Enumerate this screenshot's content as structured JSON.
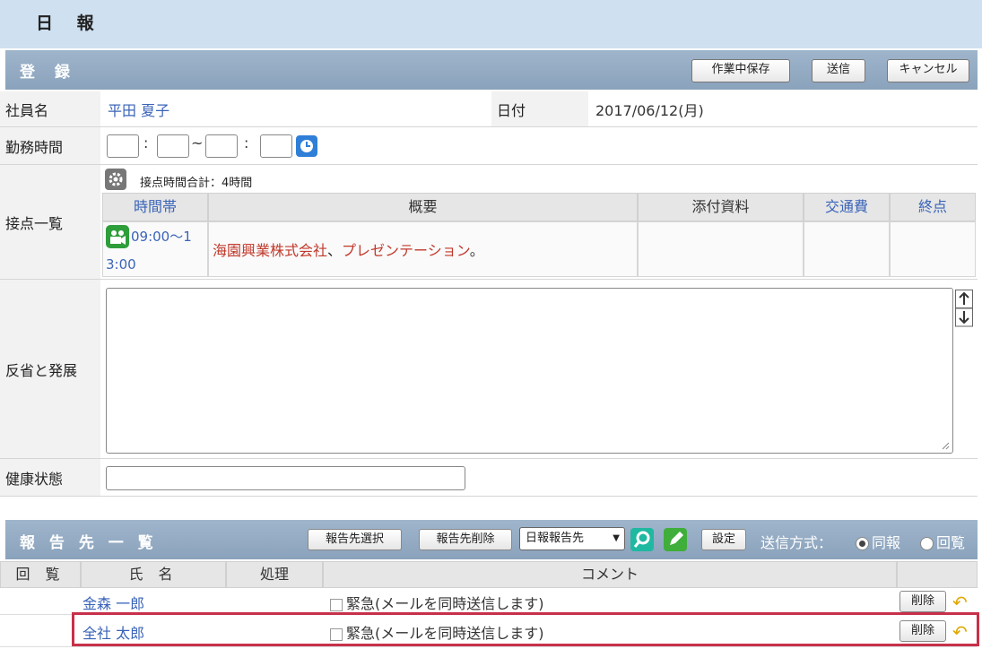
{
  "page": {
    "title": "日 報"
  },
  "register": {
    "section_title": "登 録",
    "buttons": {
      "save_progress": "作業中保存",
      "send": "送信",
      "cancel": "キャンセル"
    },
    "employee": {
      "label": "社員名",
      "value": "平田 夏子"
    },
    "date": {
      "label": "日付",
      "value": "2017/06/12(月)"
    },
    "work_time": {
      "label": "勤務時間",
      "sep1": ":",
      "range_sep": "~",
      "sep2": ":"
    },
    "contacts": {
      "label": "接点一覧",
      "total": "接点時間合計：4時間",
      "headers": {
        "time": "時間帯",
        "summary": "概要",
        "attachment": "添付資料",
        "transport": "交通費",
        "end": "終点"
      },
      "rows": [
        {
          "time_line1": "09:00〜1",
          "time_line2": "3:00",
          "company": "海園興業株式会社",
          "sep": "、",
          "activity": "プレゼンテーション",
          "end_mark": "。"
        }
      ]
    },
    "reflection": {
      "label": "反省と発展",
      "value": ""
    },
    "health": {
      "label": "健康状態",
      "value": ""
    }
  },
  "report_list": {
    "section_title": "報 告 先 一 覧",
    "select_button": "報告先選択",
    "delete_button": "報告先削除",
    "dropdown_value": "日報報告先",
    "settings_button": "設定",
    "send_method_label": "送信方式：",
    "radio_same": "同報",
    "radio_circulate": "回覧",
    "headers": {
      "circulate": "回 覧",
      "name": "氏 名",
      "process": "処理",
      "comment": "コメント"
    },
    "rows": [
      {
        "name": "金森 一郎",
        "urgent": "緊急(メールを同時送信します)",
        "delete": "削除"
      },
      {
        "name": "全社 太郎",
        "urgent": "緊急(メールを同時送信します)",
        "delete": "削除"
      }
    ]
  },
  "colors": {
    "accent_link": "#3a64b8",
    "highlight_border": "#c8304a",
    "summary_text": "#c0392b"
  }
}
